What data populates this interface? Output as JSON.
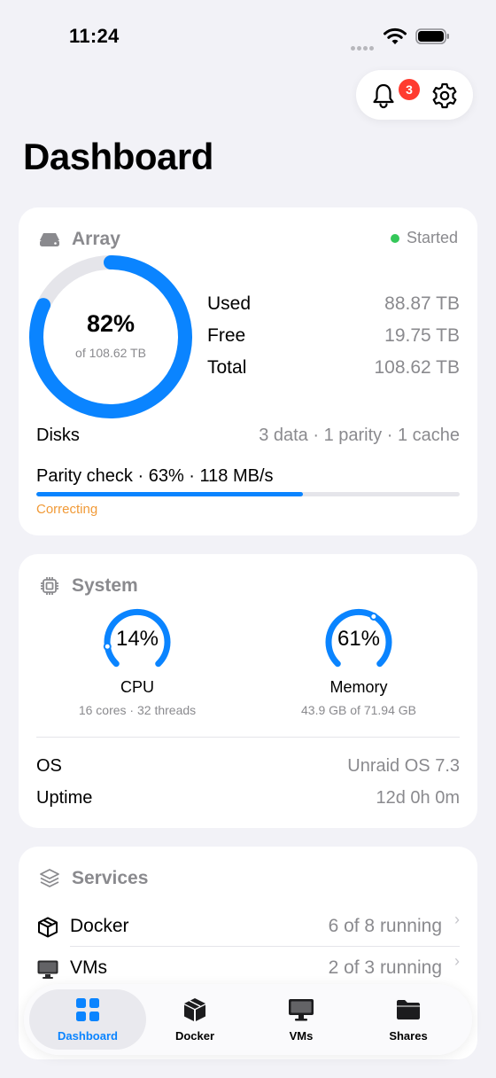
{
  "status_bar": {
    "time": "11:24"
  },
  "header": {
    "notification_count": "3",
    "title": "Dashboard"
  },
  "colors": {
    "accent": "#0a84ff",
    "started": "#34c759",
    "warning": "#f19a37",
    "badge": "#ff3b30"
  },
  "array": {
    "title": "Array",
    "status": "Started",
    "usage_fraction": 0.82,
    "percent_label": "82%",
    "capacity_label": "of 108.62 TB",
    "used_label": "Used",
    "used_value": "88.87 TB",
    "free_label": "Free",
    "free_value": "19.75 TB",
    "total_label": "Total",
    "total_value": "108.62 TB",
    "disks_label": "Disks",
    "disks_value": "3 data · 1 parity · 1 cache",
    "parity_text": "Parity check · 63% · 118 MB/s",
    "parity_progress": 0.63,
    "parity_state": "Correcting"
  },
  "system": {
    "title": "System",
    "cpu": {
      "percent_label": "14%",
      "fraction": 0.14,
      "label": "CPU",
      "detail": "16 cores · 32 threads"
    },
    "memory": {
      "percent_label": "61%",
      "fraction": 0.61,
      "label": "Memory",
      "detail": "43.9 GB of 71.94 GB"
    },
    "os_label": "OS",
    "os_value": "Unraid OS 7.3",
    "uptime_label": "Uptime",
    "uptime_value": "12d 0h 0m"
  },
  "services": {
    "title": "Services",
    "items": [
      {
        "name": "Docker",
        "value": "6 of 8 running",
        "icon": "box-icon"
      },
      {
        "name": "VMs",
        "value": "2 of 3 running",
        "icon": "monitor-icon"
      }
    ]
  },
  "tabs": [
    {
      "label": "Dashboard",
      "icon": "grid-icon",
      "active": true
    },
    {
      "label": "Docker",
      "icon": "box-icon",
      "active": false
    },
    {
      "label": "VMs",
      "icon": "monitor-icon",
      "active": false
    },
    {
      "label": "Shares",
      "icon": "folder-icon",
      "active": false
    }
  ]
}
